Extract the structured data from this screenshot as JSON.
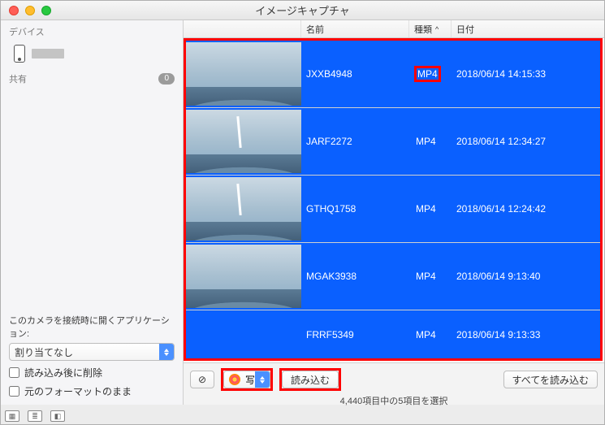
{
  "window": {
    "title": "イメージキャプチャ"
  },
  "sidebar": {
    "devices_header": "デバイス",
    "share_header": "共有",
    "share_count": "0",
    "openapp_label": "このカメラを接続時に開くアプリケーション:",
    "openapp_value": "割り当てなし",
    "chk_delete": "読み込み後に削除",
    "chk_keepfmt": "元のフォーマットのまま"
  },
  "columns": {
    "name": "名前",
    "kind": "種類",
    "date": "日付",
    "sort_caret": "^"
  },
  "rows": [
    {
      "name": "JXXB4948",
      "kind": "MP4",
      "date": "2018/06/14 14:15:33",
      "hl": true
    },
    {
      "name": "JARF2272",
      "kind": "MP4",
      "date": "2018/06/14 12:34:27",
      "hl": false
    },
    {
      "name": "GTHQ1758",
      "kind": "MP4",
      "date": "2018/06/14 12:24:42",
      "hl": false
    },
    {
      "name": "MGAK3938",
      "kind": "MP4",
      "date": "2018/06/14 9:13:40",
      "hl": false
    },
    {
      "name": "FRRF5349",
      "kind": "MP4",
      "date": "2018/06/14 9:13:33",
      "hl": false
    }
  ],
  "toolbar": {
    "prohibit_glyph": "⊘",
    "dest_label": "写真",
    "import_label": "読み込む",
    "import_all_label": "すべてを読み込む"
  },
  "status": "4,440項目中の5項目を選択"
}
